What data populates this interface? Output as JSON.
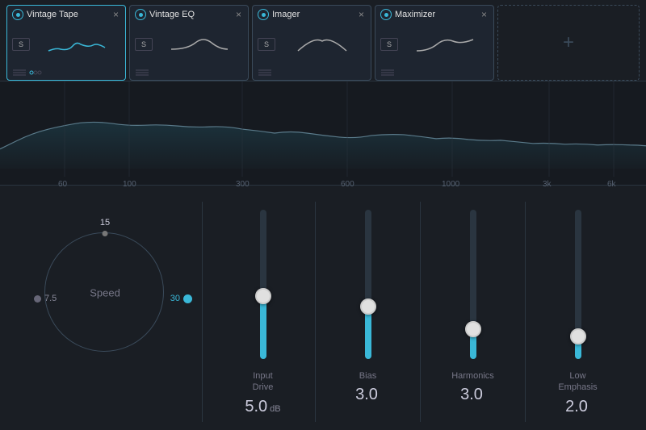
{
  "plugins": [
    {
      "id": "vintage-tape",
      "name": "Vintage Tape",
      "active": true,
      "close_label": "×"
    },
    {
      "id": "vintage-eq",
      "name": "Vintage EQ",
      "active": false,
      "close_label": "×"
    },
    {
      "id": "imager",
      "name": "Imager",
      "active": false,
      "close_label": "×"
    },
    {
      "id": "maximizer",
      "name": "Maximizer",
      "active": false,
      "close_label": "×"
    }
  ],
  "add_plugin_label": "+",
  "freq_labels": [
    "60",
    "100",
    "300",
    "600",
    "1000",
    "3k",
    "6k"
  ],
  "knob": {
    "label": "Speed",
    "value_top": "15",
    "value_left": "7.5",
    "value_right": "30"
  },
  "faders": [
    {
      "id": "input-drive",
      "label": "Input\nDrive",
      "value": "5.0",
      "unit": "dB",
      "fill_pct": 42,
      "handle_pct": 42
    },
    {
      "id": "bias",
      "label": "Bias",
      "value": "3.0",
      "unit": "",
      "fill_pct": 35,
      "handle_pct": 35
    },
    {
      "id": "harmonics",
      "label": "Harmonics",
      "value": "3.0",
      "unit": "",
      "fill_pct": 20,
      "handle_pct": 20
    },
    {
      "id": "low-emphasis",
      "label": "Low\nEmphasis",
      "value": "2.0",
      "unit": "",
      "fill_pct": 15,
      "handle_pct": 15
    }
  ],
  "colors": {
    "accent": "#3ab8d8",
    "bg_dark": "#161a20",
    "bg_mid": "#1a1e24",
    "border": "#2a3540"
  }
}
